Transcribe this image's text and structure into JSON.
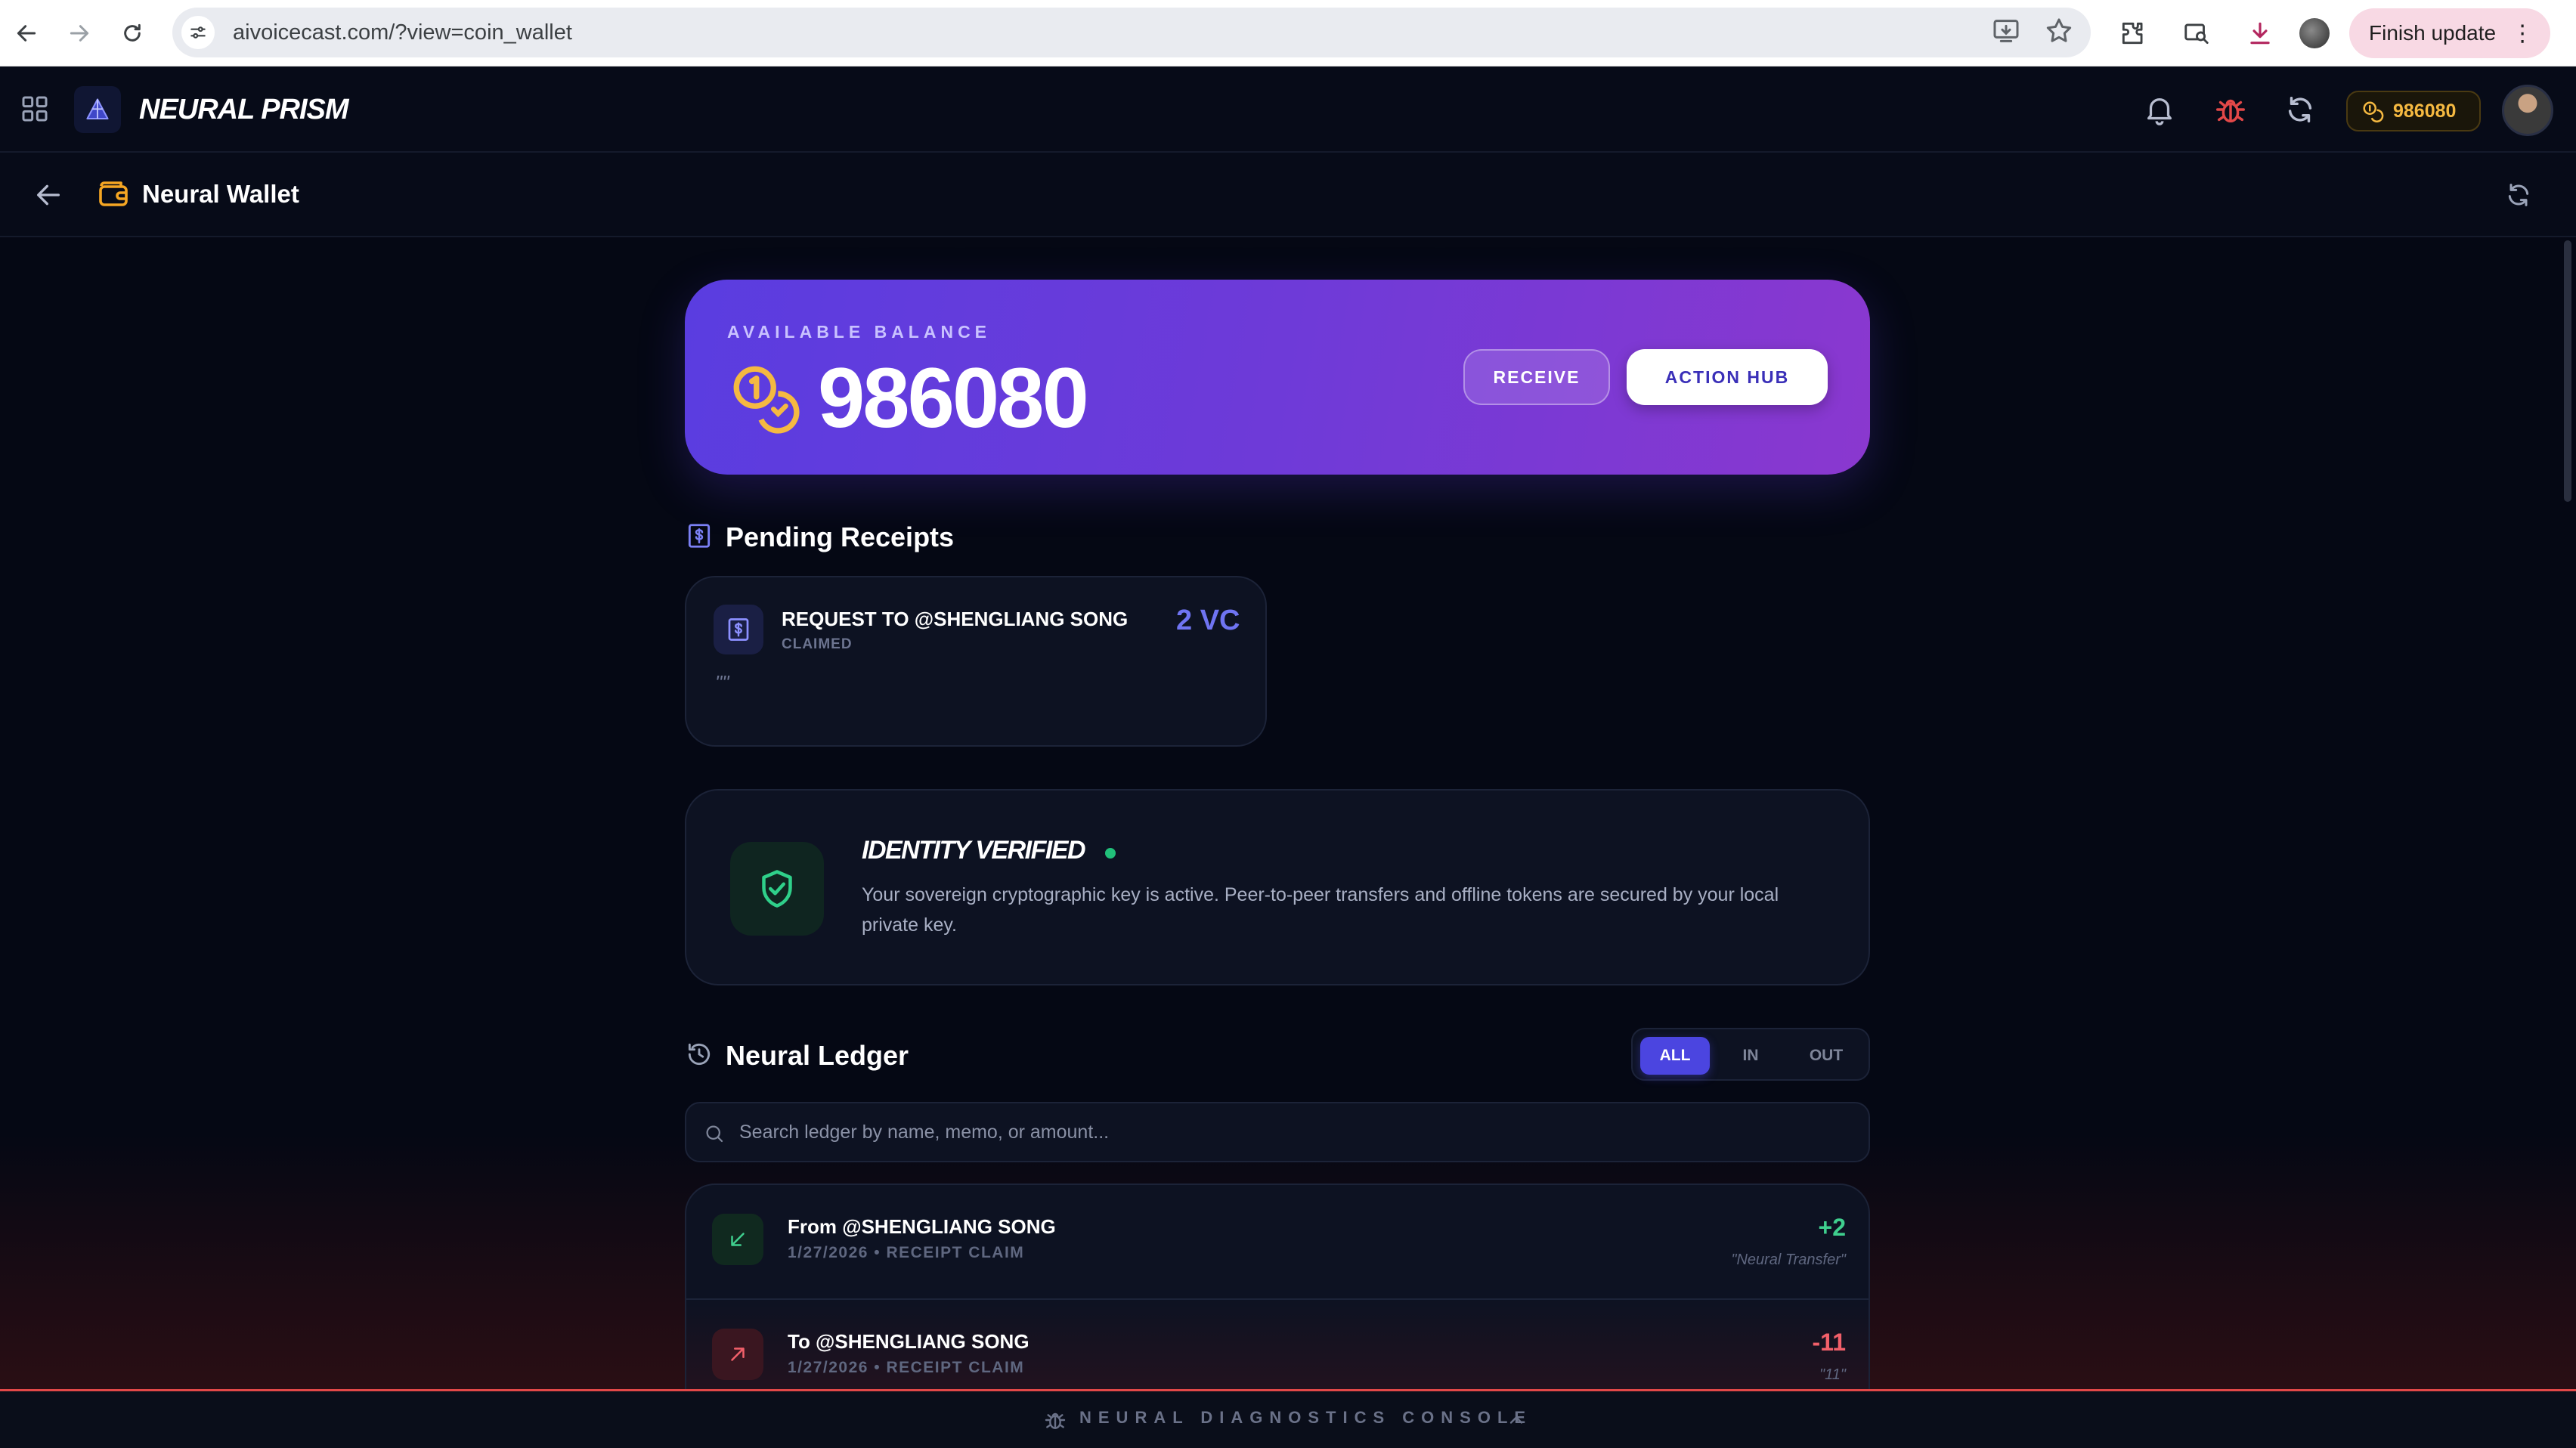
{
  "browser": {
    "url": "aivoicecast.com/?view=coin_wallet",
    "finish_update_label": "Finish update"
  },
  "app": {
    "brand": "NEURAL PRISM",
    "coin_balance_pill": "986080"
  },
  "page": {
    "title": "Neural Wallet"
  },
  "balance_card": {
    "label": "AVAILABLE BALANCE",
    "amount": "986080",
    "receive_label": "RECEIVE",
    "action_hub_label": "ACTION HUB"
  },
  "pending": {
    "title": "Pending Receipts",
    "receipts": [
      {
        "title": "REQUEST TO @SHENGLIANG SONG",
        "status": "CLAIMED",
        "amount": "2 VC",
        "memo": "\"\""
      }
    ]
  },
  "identity": {
    "title": "IDENTITY VERIFIED",
    "description": "Your sovereign cryptographic key is active. Peer-to-peer transfers and offline tokens are secured by your local private key."
  },
  "ledger": {
    "title": "Neural Ledger",
    "filters": [
      "ALL",
      "IN",
      "OUT"
    ],
    "active_filter": "ALL",
    "search_placeholder": "Search ledger by name, memo, or amount...",
    "rows": [
      {
        "name": "From @SHENGLIANG SONG",
        "meta": "1/27/2026 • RECEIPT CLAIM",
        "amount": "+2",
        "memo": "\"Neural Transfer\"",
        "direction": "in"
      },
      {
        "name": "To @SHENGLIANG SONG",
        "meta": "1/27/2026 • RECEIPT CLAIM",
        "amount": "-11",
        "memo": "\"11\"",
        "direction": "out"
      }
    ]
  },
  "console": {
    "label": "NEURAL DIAGNOSTICS CONSOLE"
  },
  "colors": {
    "accent": "#4b45e0",
    "balance_gradient_start": "#5a3de0",
    "balance_gradient_end": "#8a38cf",
    "positive": "#3fcf8e",
    "negative": "#f2606a",
    "coin_gold": "#f5b941",
    "alert_red": "#e24848"
  },
  "icons": {
    "wallet": "wallet-icon",
    "coins": "coins-icon",
    "receipt": "receipt-icon",
    "shield": "shield-check-icon",
    "history": "history-icon",
    "search": "search-icon",
    "incoming": "arrow-down-left-icon",
    "outgoing": "arrow-up-right-icon"
  }
}
